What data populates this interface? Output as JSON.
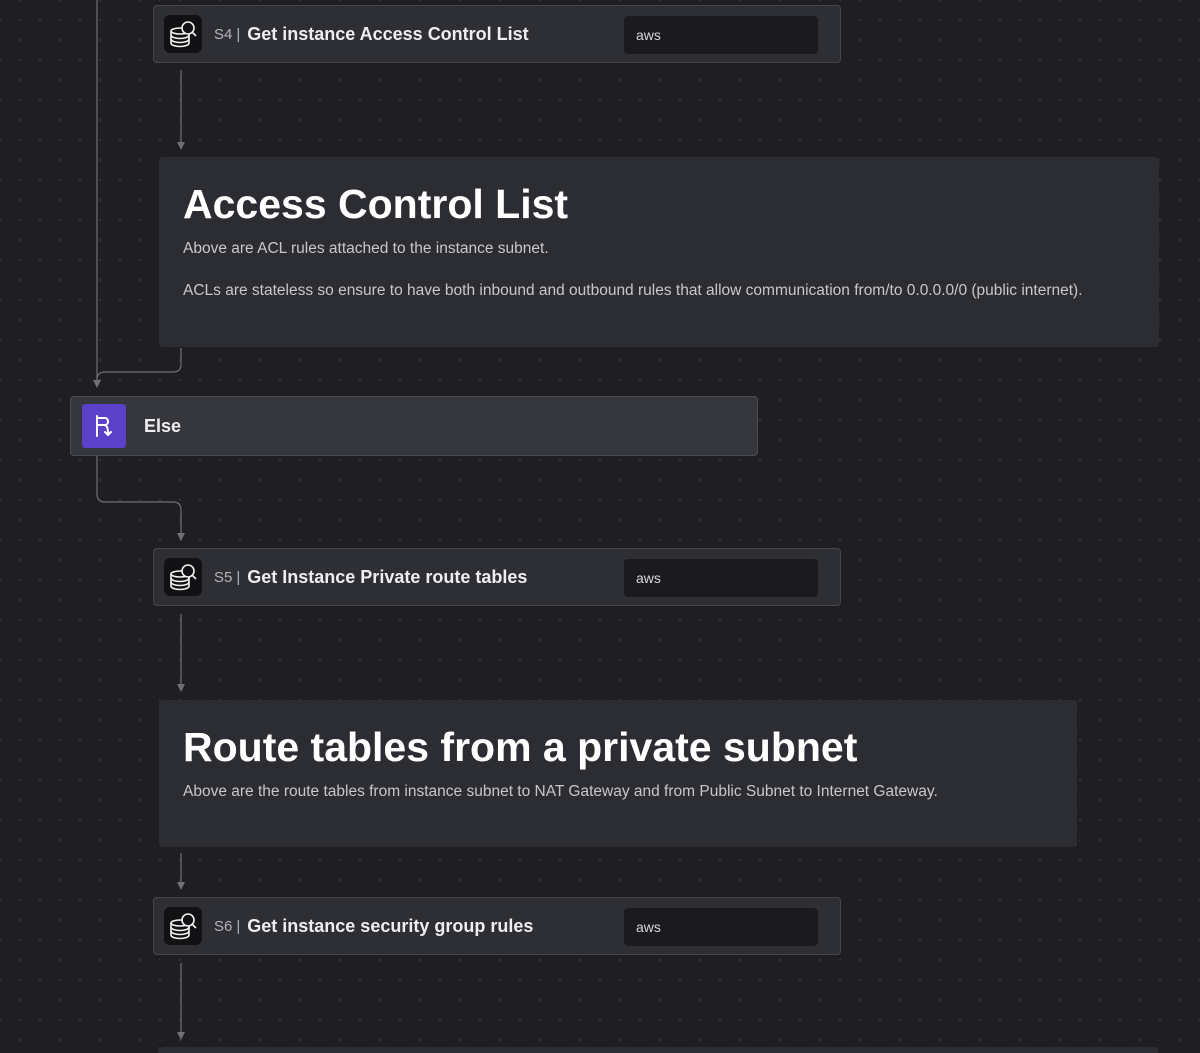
{
  "steps": {
    "s4": {
      "id": "S4",
      "separator": "|",
      "title": "Get instance Access Control List",
      "tag": "aws",
      "icon": "database-search-icon"
    },
    "s5": {
      "id": "S5",
      "separator": "|",
      "title": "Get Instance Private route tables",
      "tag": "aws",
      "icon": "database-search-icon"
    },
    "s6": {
      "id": "S6",
      "separator": "|",
      "title": "Get instance security group rules",
      "tag": "aws",
      "icon": "database-search-icon"
    }
  },
  "notes": {
    "acl": {
      "heading": "Access Control List",
      "paragraph_1": "Above are ACL rules attached to the instance subnet.",
      "paragraph_2": "ACLs are stateless so ensure to have both inbound and outbound rules that allow communication from/to 0.0.0.0/0 (public internet)."
    },
    "routes": {
      "heading": "Route tables from a private subnet",
      "paragraph_1": "Above are the route tables from instance subnet to NAT Gateway and from Public Subnet to Internet Gateway."
    }
  },
  "branch": {
    "label": "Else",
    "icon": "branch-icon",
    "accent_color": "#5b41c9"
  },
  "colors": {
    "canvas_background": "#1f1f23",
    "node_background": "#2e2f34",
    "connector": "#6f7077"
  }
}
